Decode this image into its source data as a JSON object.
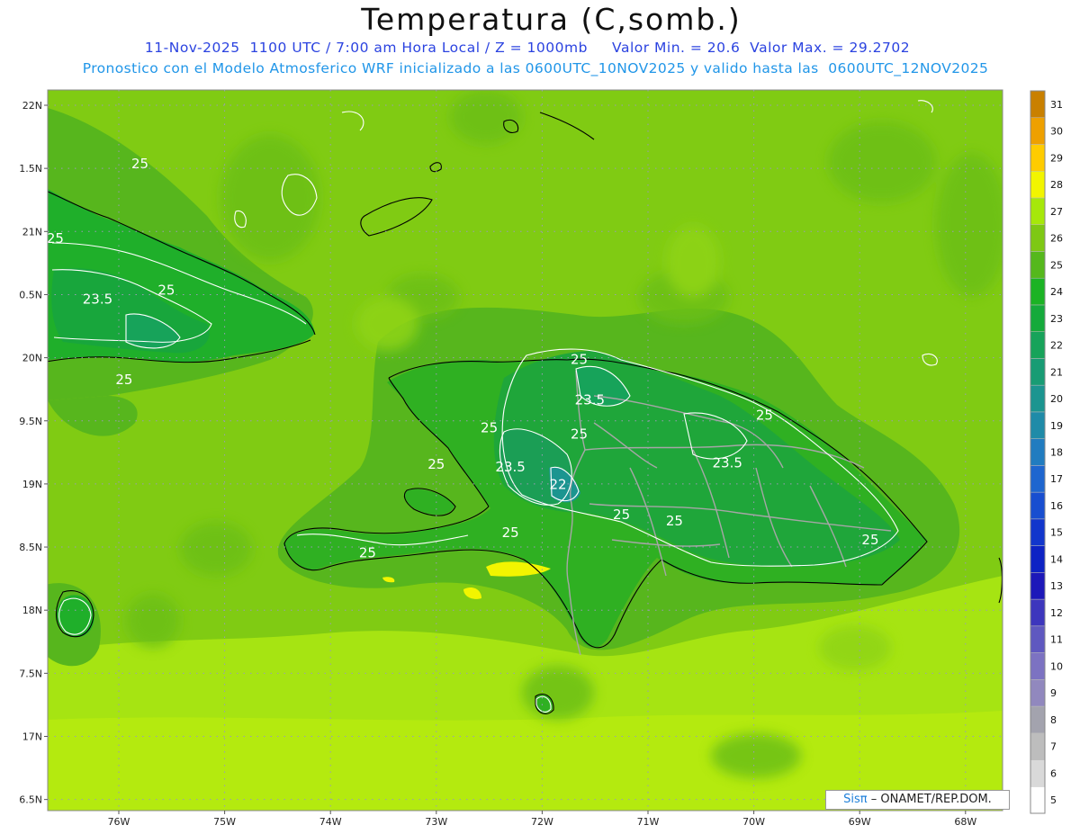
{
  "title": "Temperatura (C,somb.)",
  "subtitle1": "11-Nov-2025  1100 UTC / 7:00 am Hora Local / Z = 1000mb     Valor Min. = 20.6  Valor Max. = 29.2702",
  "subtitle2": "Pronostico con el Modelo Atmosferico WRF inicializado a las 0600UTC_10NOV2025 y valido hasta las  0600UTC_12NOV2025",
  "credit": {
    "sis": "Sisπ",
    "org": "– ONAMET/REP.DOM."
  },
  "lat_ticks": [
    {
      "label": "22N",
      "lat": 22.0
    },
    {
      "label": "1.5N",
      "lat": 21.5
    },
    {
      "label": "21N",
      "lat": 21.0
    },
    {
      "label": "0.5N",
      "lat": 20.5
    },
    {
      "label": "20N",
      "lat": 20.0
    },
    {
      "label": "9.5N",
      "lat": 19.5
    },
    {
      "label": "19N",
      "lat": 19.0
    },
    {
      "label": "8.5N",
      "lat": 18.5
    },
    {
      "label": "18N",
      "lat": 18.0
    },
    {
      "label": "7.5N",
      "lat": 17.5
    },
    {
      "label": "17N",
      "lat": 17.0
    },
    {
      "label": "6.5N",
      "lat": 16.5
    }
  ],
  "lon_ticks": [
    {
      "label": "76W",
      "lon": -76
    },
    {
      "label": "75W",
      "lon": -75
    },
    {
      "label": "74W",
      "lon": -74
    },
    {
      "label": "73W",
      "lon": -73
    },
    {
      "label": "72W",
      "lon": -72
    },
    {
      "label": "71W",
      "lon": -71
    },
    {
      "label": "70W",
      "lon": -70
    },
    {
      "label": "69W",
      "lon": -69
    },
    {
      "label": "68W",
      "lon": -68
    }
  ],
  "colorbar": [
    {
      "value": "5",
      "color": "#ffffff"
    },
    {
      "value": "6",
      "color": "#d9d9d9"
    },
    {
      "value": "7",
      "color": "#bdbdbd"
    },
    {
      "value": "8",
      "color": "#a3a3ae"
    },
    {
      "value": "9",
      "color": "#9188be"
    },
    {
      "value": "10",
      "color": "#7c72c2"
    },
    {
      "value": "11",
      "color": "#5f58c0"
    },
    {
      "value": "12",
      "color": "#3d36bd"
    },
    {
      "value": "13",
      "color": "#1d18b9"
    },
    {
      "value": "14",
      "color": "#0d22c4"
    },
    {
      "value": "15",
      "color": "#1236cc"
    },
    {
      "value": "16",
      "color": "#184ed0"
    },
    {
      "value": "17",
      "color": "#1e66cf"
    },
    {
      "value": "18",
      "color": "#217cc0"
    },
    {
      "value": "19",
      "color": "#1f8ba8"
    },
    {
      "value": "20",
      "color": "#1b9590"
    },
    {
      "value": "21",
      "color": "#189c74"
    },
    {
      "value": "22",
      "color": "#17a35a"
    },
    {
      "value": "23",
      "color": "#15aa3b"
    },
    {
      "value": "24",
      "color": "#1bb324"
    },
    {
      "value": "25",
      "color": "#55b81c"
    },
    {
      "value": "26",
      "color": "#7ec814"
    },
    {
      "value": "27",
      "color": "#a6e80a"
    },
    {
      "value": "28",
      "color": "#f2f500"
    },
    {
      "value": "29",
      "color": "#ffcc00"
    },
    {
      "value": "30",
      "color": "#eea000"
    },
    {
      "value": "31",
      "color": "#c98000"
    }
  ],
  "contour_labels": [
    {
      "text": "25",
      "lon": -75.8,
      "lat": 21.5
    },
    {
      "text": "25",
      "lon": -76.6,
      "lat": 20.91
    },
    {
      "text": "23.5",
      "lon": -77.1,
      "lat": 20.58
    },
    {
      "text": "23.5",
      "lon": -76.97,
      "lat": 20.43
    },
    {
      "text": "23.5",
      "lon": -76.2,
      "lat": 20.43
    },
    {
      "text": "25",
      "lon": -75.55,
      "lat": 20.5
    },
    {
      "text": "25",
      "lon": -75.95,
      "lat": 19.79
    },
    {
      "text": "25",
      "lon": -71.65,
      "lat": 19.95
    },
    {
      "text": "23.5",
      "lon": -71.55,
      "lat": 19.63
    },
    {
      "text": "25",
      "lon": -71.65,
      "lat": 19.36
    },
    {
      "text": "25",
      "lon": -72.5,
      "lat": 19.41
    },
    {
      "text": "25",
      "lon": -73.0,
      "lat": 19.12
    },
    {
      "text": "23.5",
      "lon": -72.3,
      "lat": 19.1
    },
    {
      "text": "22",
      "lon": -71.85,
      "lat": 18.96
    },
    {
      "text": "23.5",
      "lon": -70.25,
      "lat": 19.13
    },
    {
      "text": "25",
      "lon": -69.9,
      "lat": 19.51
    },
    {
      "text": "25",
      "lon": -71.25,
      "lat": 18.72
    },
    {
      "text": "25",
      "lon": -70.75,
      "lat": 18.67
    },
    {
      "text": "25",
      "lon": -72.3,
      "lat": 18.58
    },
    {
      "text": "25",
      "lon": -73.65,
      "lat": 18.42
    },
    {
      "text": "25",
      "lon": -68.9,
      "lat": 18.52
    }
  ]
}
